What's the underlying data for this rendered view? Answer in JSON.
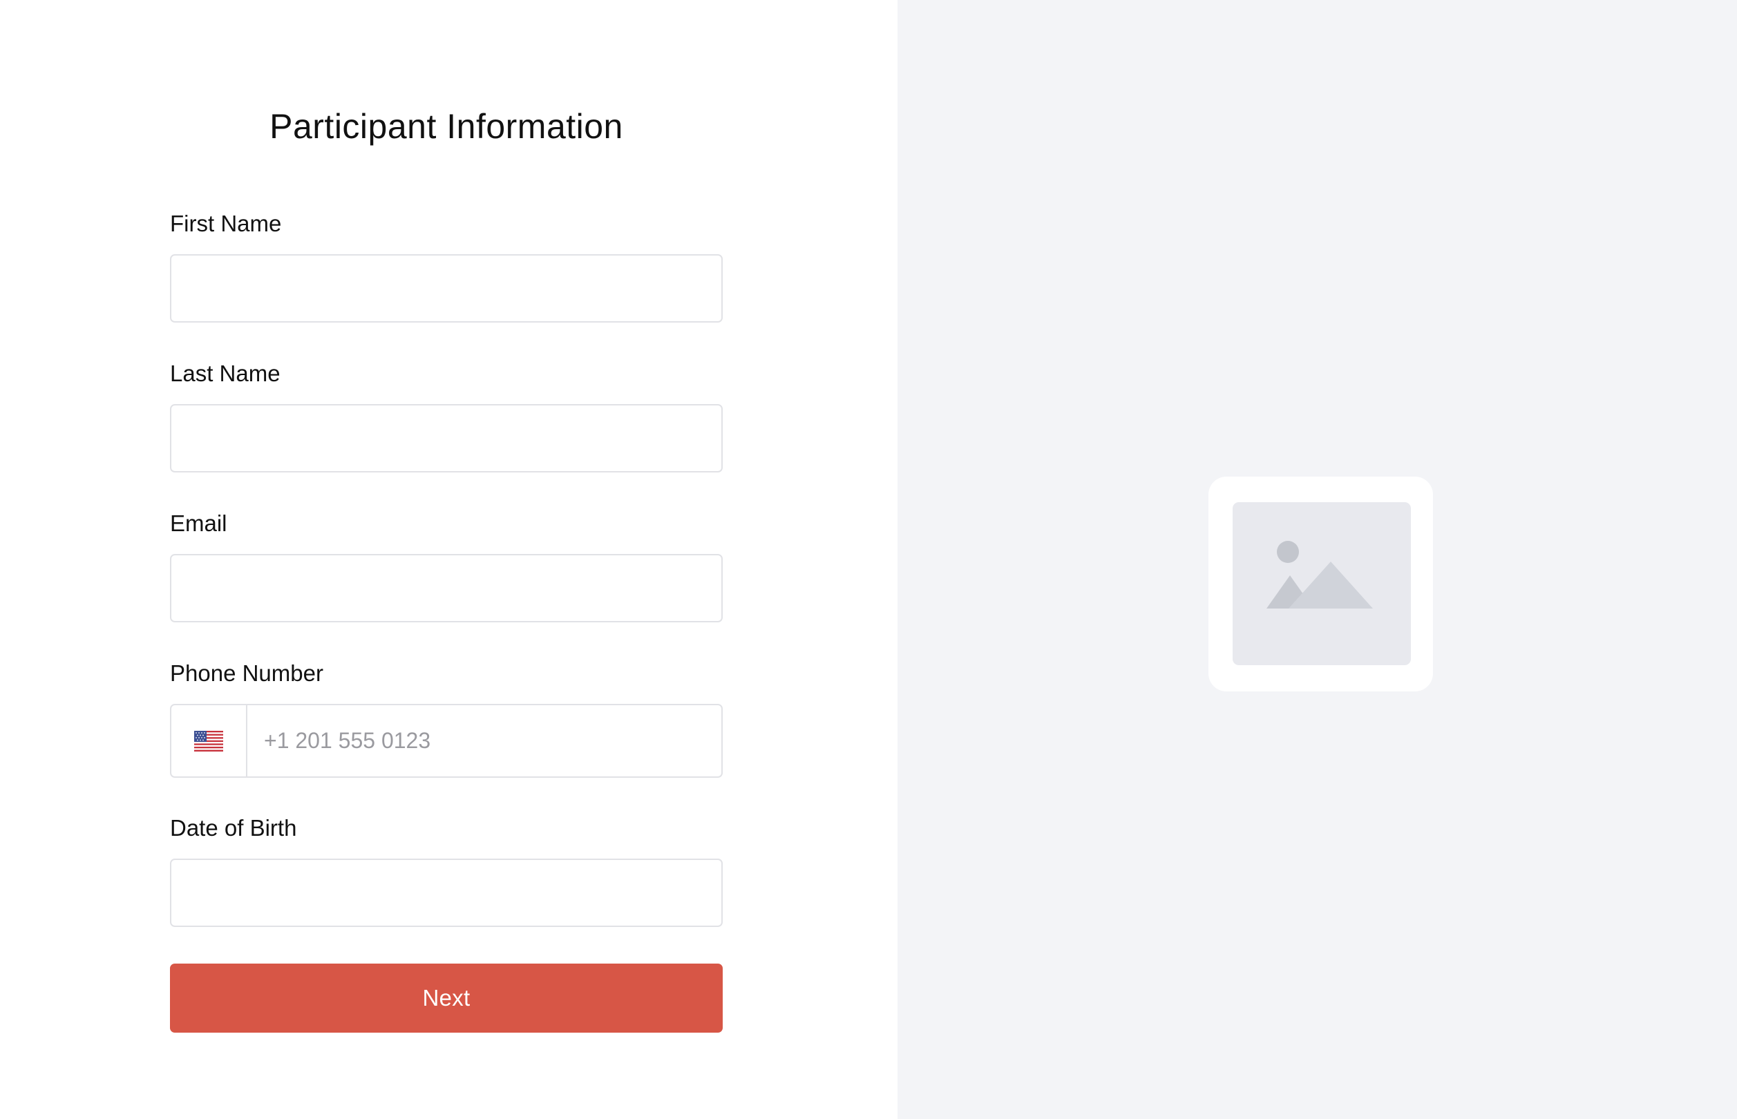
{
  "form": {
    "title": "Participant Information",
    "fields": {
      "first_name": {
        "label": "First Name",
        "value": "",
        "placeholder": ""
      },
      "last_name": {
        "label": "Last Name",
        "value": "",
        "placeholder": ""
      },
      "email": {
        "label": "Email",
        "value": "",
        "placeholder": ""
      },
      "phone": {
        "label": "Phone Number",
        "country_flag": "us-flag-icon",
        "value": "",
        "placeholder": "+1 201 555 0123"
      },
      "date_of_birth": {
        "label": "Date of Birth",
        "value": "",
        "placeholder": ""
      }
    },
    "next_label": "Next"
  },
  "side_panel": {
    "icon": "image-placeholder-icon"
  },
  "colors": {
    "accent": "#d75646",
    "side_panel_bg": "#f3f4f7",
    "input_border": "#e1e2e6"
  }
}
